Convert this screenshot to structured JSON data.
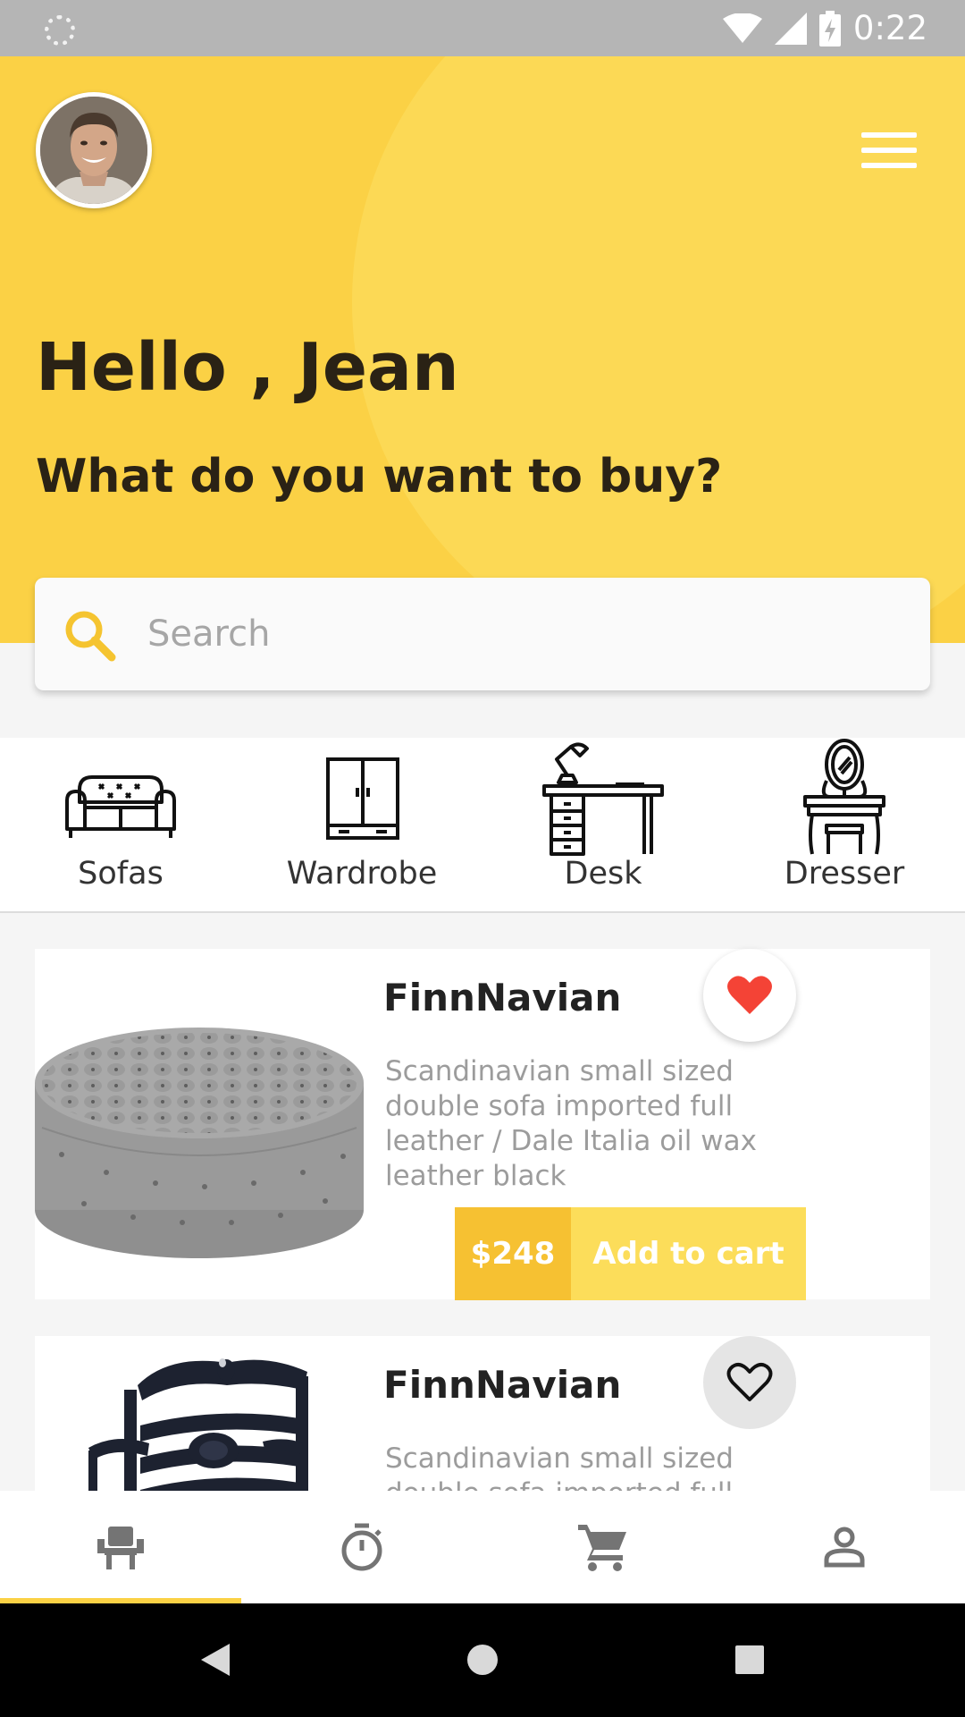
{
  "status_bar": {
    "time": "0:22",
    "icons": [
      "loading-icon",
      "wifi-icon",
      "signal-icon",
      "battery-charging-icon"
    ]
  },
  "header": {
    "greeting": "Hello , Jean",
    "question": "What do you want to buy?",
    "menu_icon": "hamburger-menu-icon",
    "colors": {
      "background": "#fbd145",
      "accent_circle": "#fcd955",
      "text": "#2a2215"
    }
  },
  "search": {
    "placeholder": "Search",
    "value": "",
    "icon": "search-icon",
    "icon_color": "#f5c430"
  },
  "categories": [
    {
      "label": "Sofas",
      "icon": "sofa-icon"
    },
    {
      "label": "Wardrobe",
      "icon": "wardrobe-icon"
    },
    {
      "label": "Desk",
      "icon": "desk-icon"
    },
    {
      "label": "Dresser",
      "icon": "dresser-icon"
    }
  ],
  "products": [
    {
      "name": "FinnNavian",
      "description": "Scandinavian small sized double sofa imported full leather / Dale Italia oil wax leather black",
      "price": "$248",
      "cta": "Add to cart",
      "favorite": true,
      "image": "tufted-ottoman-image"
    },
    {
      "name": "FinnNavian",
      "description": "Scandinavian small sized double sofa imported full",
      "favorite": false,
      "image": "wooden-chair-image"
    }
  ],
  "bottom_nav": [
    {
      "name": "furniture",
      "icon": "chair-icon",
      "active": true
    },
    {
      "name": "timer",
      "icon": "stopwatch-icon",
      "active": false
    },
    {
      "name": "cart",
      "icon": "cart-icon",
      "active": false
    },
    {
      "name": "profile",
      "icon": "person-icon",
      "active": false
    }
  ],
  "system_nav": [
    "back-icon",
    "home-icon",
    "recents-icon"
  ],
  "colors": {
    "price": "#f6c132",
    "add_to_cart": "#fcdd5a",
    "heart": "#f44336",
    "nav_indicator": "#fbd145"
  }
}
